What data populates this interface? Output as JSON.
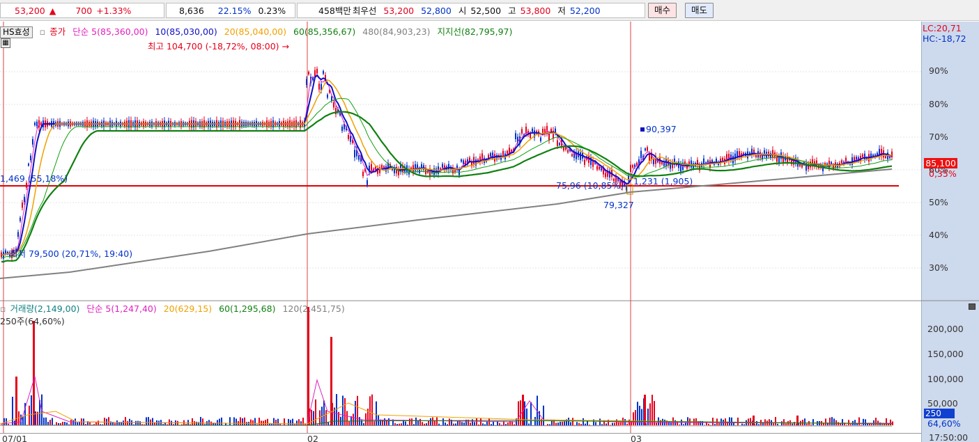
{
  "quote_bar": {
    "price": "53,200",
    "change_arrow": "▲",
    "change": "700",
    "change_pct": "+1.33%",
    "volume_ratio": "8,636",
    "turnover": "22.15%",
    "rate": "0.23%",
    "amount": "458백만",
    "best_label": "최우선",
    "best_ask": "53,200",
    "best_bid": "52,800",
    "open_label": "시",
    "open": "52,500",
    "high_label": "고",
    "high": "53,800",
    "low_label": "저",
    "low": "52,200",
    "buy_button": "매수",
    "sell_button": "매도"
  },
  "price_legend": {
    "effect_button": "HS효성",
    "close_label": "종가",
    "ma5": "단순 5(85,360,00)",
    "ma10": "10(85,030,00)",
    "ma20": "20(85,040,00)",
    "ma60": "60(85,356,67)",
    "ma480": "480(84,903,23)",
    "support": "지지선(82,795,97)"
  },
  "volume_legend": {
    "volume": "거래량(2,149,00)",
    "ma5": "단순 5(1,247,40)",
    "ma20": "20(629,15)",
    "ma60": "60(1,295,68)",
    "ma120": "120(2,451,75)",
    "sub": "250주(64,60%)"
  },
  "annotations": {
    "high_note": "최고 104,700 (-18,72%, 08:00)",
    "arrow": "→",
    "left_note": "1,469 (55,18%)",
    "low_note": "최저 79,500 (20,71%, 19:40)",
    "peak_note": "90,397",
    "mid_note": "75,96 (10,85%)",
    "mid_note2": "1,231 (1,905)",
    "bottom_note": "79,327"
  },
  "right_axis": {
    "lc": "LC:20,71",
    "hc": "HC:-18,72",
    "pct_ticks": [
      "90%",
      "80%",
      "70%",
      "60%",
      "50%",
      "40%",
      "30%"
    ],
    "price_tag": "85,100",
    "price_tag_pct": "0,35%",
    "vol_ticks": [
      "200,000",
      "150,000",
      "100,000",
      "50,000"
    ],
    "vol_tag": "250",
    "vol_tag_pct": "64,60%",
    "time": "17:50:00"
  },
  "dates": [
    "07/01",
    "02",
    "03"
  ],
  "colors": {
    "up": "#e5001a",
    "down": "#0032c8",
    "ma5": "#e020c0",
    "ma10": "#1010c0",
    "ma20": "#f0a000",
    "ma60": "#108010",
    "ma480": "#808080",
    "support_line": "#e00000"
  }
}
